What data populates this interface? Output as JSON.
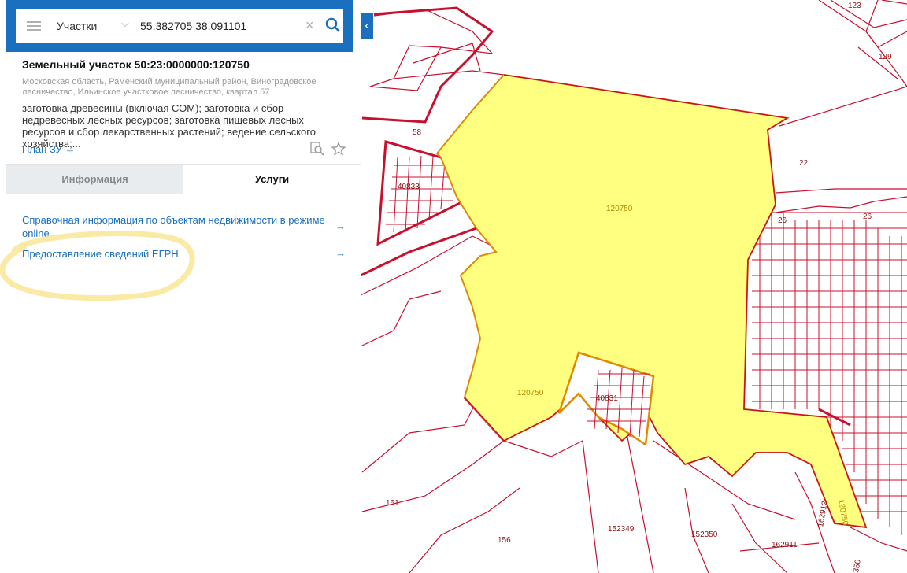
{
  "search": {
    "layer_label": "Участки",
    "query": "55.382705 38.091101"
  },
  "parcel": {
    "title": "Земельный участок 50:23:0000000:120750",
    "address": "Московская область, Раменский муниципальный район, Виноградовское лесничество, Ильинское участковое лесничество, квартал 57",
    "purpose": "заготовка древесины (включая СОМ); заготовка и сбор недревесных лесных ресурсов; заготовка пищевых лесных ресурсов и сбор лекарственных растений; ведение сельского хозяйства;...",
    "plan_link": "План ЗУ →"
  },
  "tabs": {
    "info": "Информация",
    "services": "Услуги"
  },
  "services": [
    {
      "label": "Справочная информация по объектам недвижимости в режиме online",
      "arrow": "→"
    },
    {
      "label": "Предоставление сведений ЕГРН",
      "arrow": "→"
    }
  ],
  "map": {
    "main_parcel_label": "120750",
    "labels": [
      "123",
      "129",
      "58",
      "22",
      "26",
      "26",
      "40833",
      "40831",
      "120750",
      "120750",
      "161",
      "156",
      "152349",
      "152350",
      "162911",
      "162912",
      "350"
    ]
  },
  "colors": {
    "accent": "#1a6fbf",
    "boundary": "#c8102e",
    "parcel_fill": "#ffff80",
    "highlight": "#fbe9a6"
  }
}
